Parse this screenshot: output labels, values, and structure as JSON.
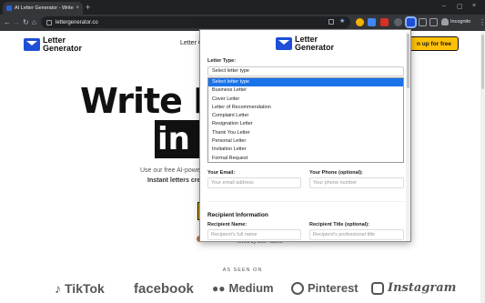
{
  "browser": {
    "tab_title": "AI Letter Generator - Write Pe…",
    "tab_close": "×",
    "new_tab": "+",
    "window_min": "–",
    "window_max": "▢",
    "window_close": "×",
    "back": "←",
    "forward": "→",
    "reload": "↻",
    "home": "⌂",
    "url": "lettergenerator.co",
    "incognito_label": "Incognito",
    "menu": "⋮"
  },
  "site": {
    "logo_line1": "Letter",
    "logo_line2": "Generator",
    "nav_link": "Letter G",
    "signup_label": "n up for free",
    "hero_line1": "Write Pe",
    "hero_line2": "in S",
    "sub_line1": "Use our free AI-powe",
    "sub_line2": "Instant letters cre",
    "loved": "loved by 500+ users",
    "as_seen_on": "AS SEEN ON",
    "brands": [
      "TikTok",
      "facebook",
      "Medium",
      "Pinterest",
      "Instagram"
    ]
  },
  "popup": {
    "logo_line1": "Letter",
    "logo_line2": "Generator",
    "letter_type_label": "Letter Type:",
    "letter_type_selected": "Select letter type",
    "options": [
      "Select letter type",
      "Business Letter",
      "Cover Letter",
      "Letter of Recommendation",
      "Complaint Letter",
      "Resignation Letter",
      "Thank You Letter",
      "Personal Letter",
      "Invitation Letter",
      "Formal Request"
    ],
    "email_label": "Your Email:",
    "email_placeholder": "Your email address",
    "phone_label": "Your Phone (optional):",
    "phone_placeholder": "Your phone number",
    "recipient_section": "Recipient Information",
    "recipient_name_label": "Recipient Name:",
    "recipient_name_placeholder": "Recipient's full name",
    "recipient_title_label": "Recipient Title (optional):",
    "recipient_title_placeholder": "Recipient's professional title"
  },
  "colors": {
    "brand_blue": "#1e4fd6",
    "cta_yellow": "#ffc107",
    "selection_blue": "#1a73e8",
    "chrome_dark": "#202124"
  }
}
